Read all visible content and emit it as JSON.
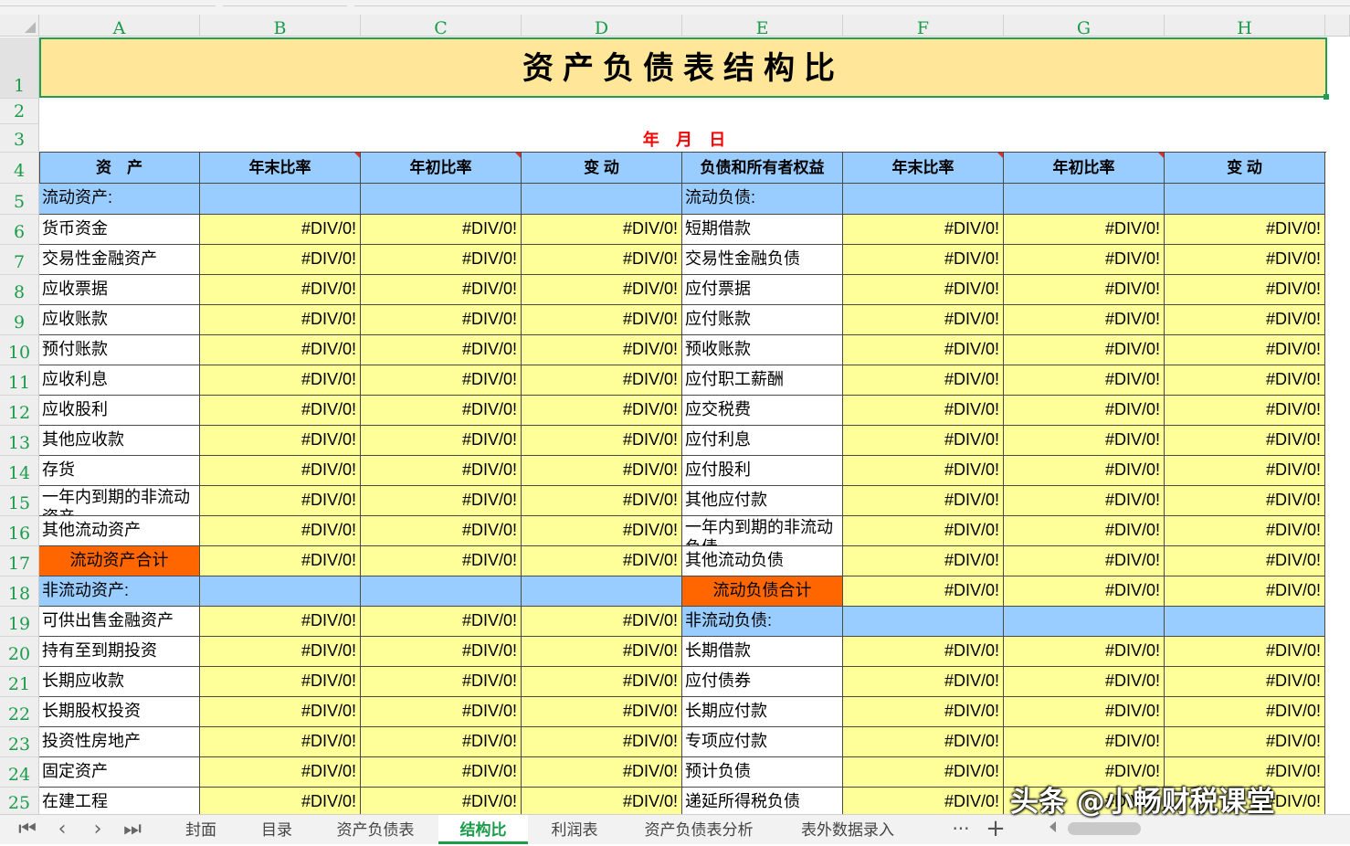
{
  "columns": [
    "A",
    "B",
    "C",
    "D",
    "E",
    "F",
    "G",
    "H"
  ],
  "rows": [
    "1",
    "2",
    "3",
    "4",
    "5",
    "6",
    "7",
    "8",
    "9",
    "10",
    "11",
    "12",
    "13",
    "14",
    "15",
    "16",
    "17",
    "18",
    "19",
    "20",
    "21",
    "22",
    "23",
    "24",
    "25"
  ],
  "title": "资产负债表结构比",
  "date_line": "年 月 日",
  "headers": [
    "资　产",
    "年末比率",
    "年初比率",
    "变 动",
    "负债和所有者权益",
    "年末比率",
    "年初比率",
    "变 动"
  ],
  "error_value": "#DIV/0!",
  "left_section_current": "流动资产:",
  "right_section_current": "流动负债:",
  "left_current_items": [
    "货币资金",
    "交易性金融资产",
    "应收票据",
    "应收账款",
    "预付账款",
    "应收利息",
    "应收股利",
    "其他应收款",
    "存货",
    "一年内到期的非流动资产",
    "其他流动资产"
  ],
  "left_current_total": "流动资产合计",
  "left_section_noncurrent": "非流动资产:",
  "left_noncurrent_items": [
    "可供出售金融资产",
    "持有至到期投资",
    "长期应收款",
    "长期股权投资",
    "投资性房地产",
    "固定资产",
    "在建工程"
  ],
  "right_current_items": [
    "短期借款",
    "交易性金融负债",
    "应付票据",
    "应付账款",
    "预收账款",
    "应付职工薪酬",
    "应交税费",
    "应付利息",
    "应付股利",
    "其他应付款",
    "一年内到期的非流动负债",
    "其他流动负债"
  ],
  "right_current_total": "流动负债合计",
  "right_section_noncurrent": "非流动负债:",
  "right_noncurrent_items": [
    "长期借款",
    "应付债券",
    "长期应付款",
    "专项应付款",
    "预计负债",
    "递延所得税负债"
  ],
  "sheet_tabs": [
    "封面",
    "目录",
    "资产负债表",
    "结构比",
    "利润表",
    "资产负债表分析",
    "表外数据录入"
  ],
  "active_tab": "结构比",
  "tab_more": "···",
  "tab_add": "+",
  "watermark": "头条 @小畅财税课堂",
  "colors": {
    "header_blue": "#99ccff",
    "value_yellow": "#ffff99",
    "total_orange": "#ff6600",
    "title_fill": "#ffe699",
    "accent_green": "#1a9c4a",
    "date_red": "#ff0000"
  }
}
